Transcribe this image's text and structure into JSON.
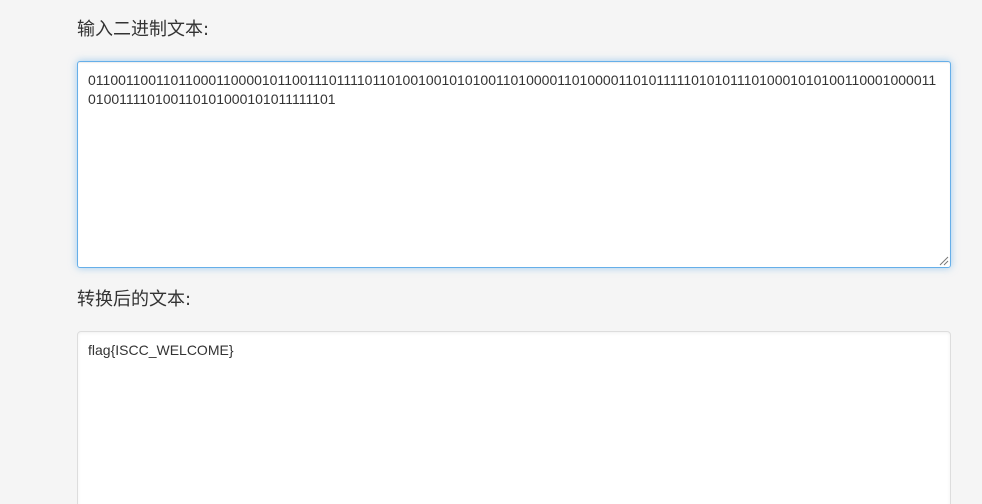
{
  "input_section": {
    "label": "输入二进制文本:",
    "value": "0110011001101100011000010110011101111011010010010101001101000011010000110101111101010111010001010100110001000011010011110100110101000101011111101"
  },
  "output_section": {
    "label": "转换后的文本:",
    "value": "flag{ISCC_WELCOME}"
  }
}
